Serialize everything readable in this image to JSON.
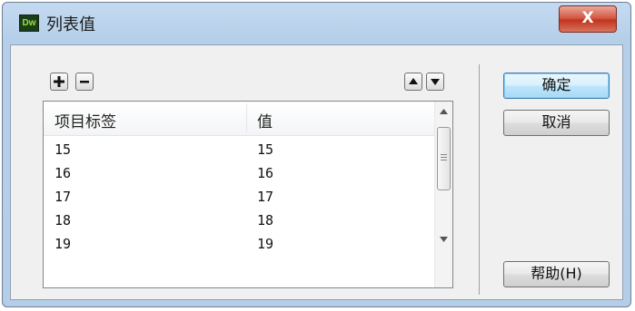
{
  "window": {
    "title": "列表值",
    "app_icon_text": "Dw",
    "close_label": "X"
  },
  "toolbar": {
    "add_icon": "plus-icon",
    "remove_icon": "minus-icon",
    "move_up_icon": "triangle-up-icon",
    "move_down_icon": "triangle-down-icon"
  },
  "list": {
    "columns": [
      "项目标签",
      "值"
    ],
    "rows": [
      {
        "label": "15",
        "value": "15"
      },
      {
        "label": "16",
        "value": "16"
      },
      {
        "label": "17",
        "value": "17"
      },
      {
        "label": "18",
        "value": "18"
      },
      {
        "label": "19",
        "value": "19"
      }
    ]
  },
  "buttons": {
    "ok": "确定",
    "cancel": "取消",
    "help": "帮助(H)"
  },
  "colors": {
    "close_button": "#c8402b",
    "default_button_border": "#3c7fb1",
    "title_gradient_top": "#c4daf1"
  }
}
